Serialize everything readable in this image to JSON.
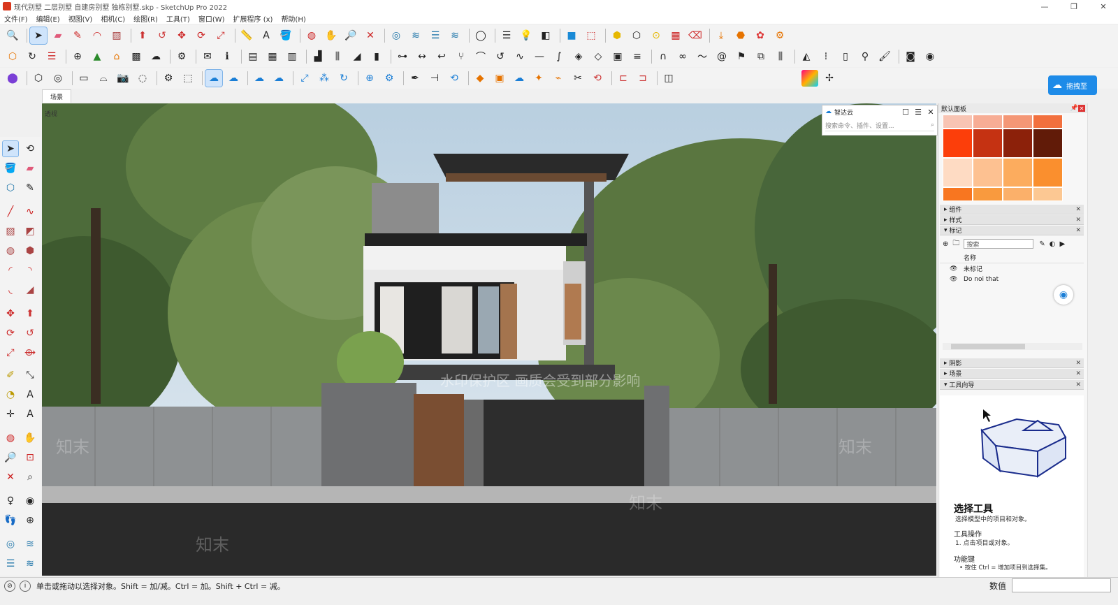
{
  "window": {
    "title": "现代别墅 二层别墅 自建房别墅 独栋别墅.skp - SketchUp Pro 2022",
    "controls": [
      "—",
      "❐",
      "✕"
    ]
  },
  "menu": [
    "文件(F)",
    "编辑(E)",
    "视图(V)",
    "相机(C)",
    "绘图(R)",
    "工具(T)",
    "窗口(W)",
    "扩展程序 (x)",
    "帮助(H)"
  ],
  "scene_tab": "场景",
  "viewport": {
    "watermark_center": "水印保护区 画质会受到部分影响",
    "watermark_mark": "知末",
    "corner_label": "透视"
  },
  "zhidayun": {
    "title": "智达云",
    "search_placeholder": "搜索命令、插件、设置...",
    "side_button": "拖拽至"
  },
  "tray": {
    "title": "默认面板",
    "swatches": [
      "#f8c4b3",
      "#f7ad95",
      "#f49776",
      "#f2703e",
      "#fc3e0a",
      "#c53212",
      "#8c210a",
      "#611b08",
      "#fedbc3",
      "#fdc191",
      "#fcac5e",
      "#fa8f2e",
      "#f87620",
      "#f99a3e",
      "#fbb06a",
      "#fcc893"
    ],
    "panels_top": [
      "组件",
      "样式",
      "标记"
    ],
    "tag_search": "搜索",
    "tag_header": "名称",
    "tags": [
      "未标记",
      "Do noi that"
    ],
    "panels_bottom": [
      "阴影",
      "场景",
      "工具向导"
    ],
    "instructor": {
      "tool_name": "选择工具",
      "tool_desc": "选择模型中的项目和对象。",
      "ops_title": "工具操作",
      "ops_1": "1. 点击项目或对象。",
      "keys_title": "功能键",
      "keys_1": "• 按住 Ctrl = 增加项目到选择集。"
    }
  },
  "status": {
    "text": "单击或拖动以选择对象。Shift = 加/减。Ctrl = 加。Shift + Ctrl = 减。",
    "measure_label": "数值"
  }
}
